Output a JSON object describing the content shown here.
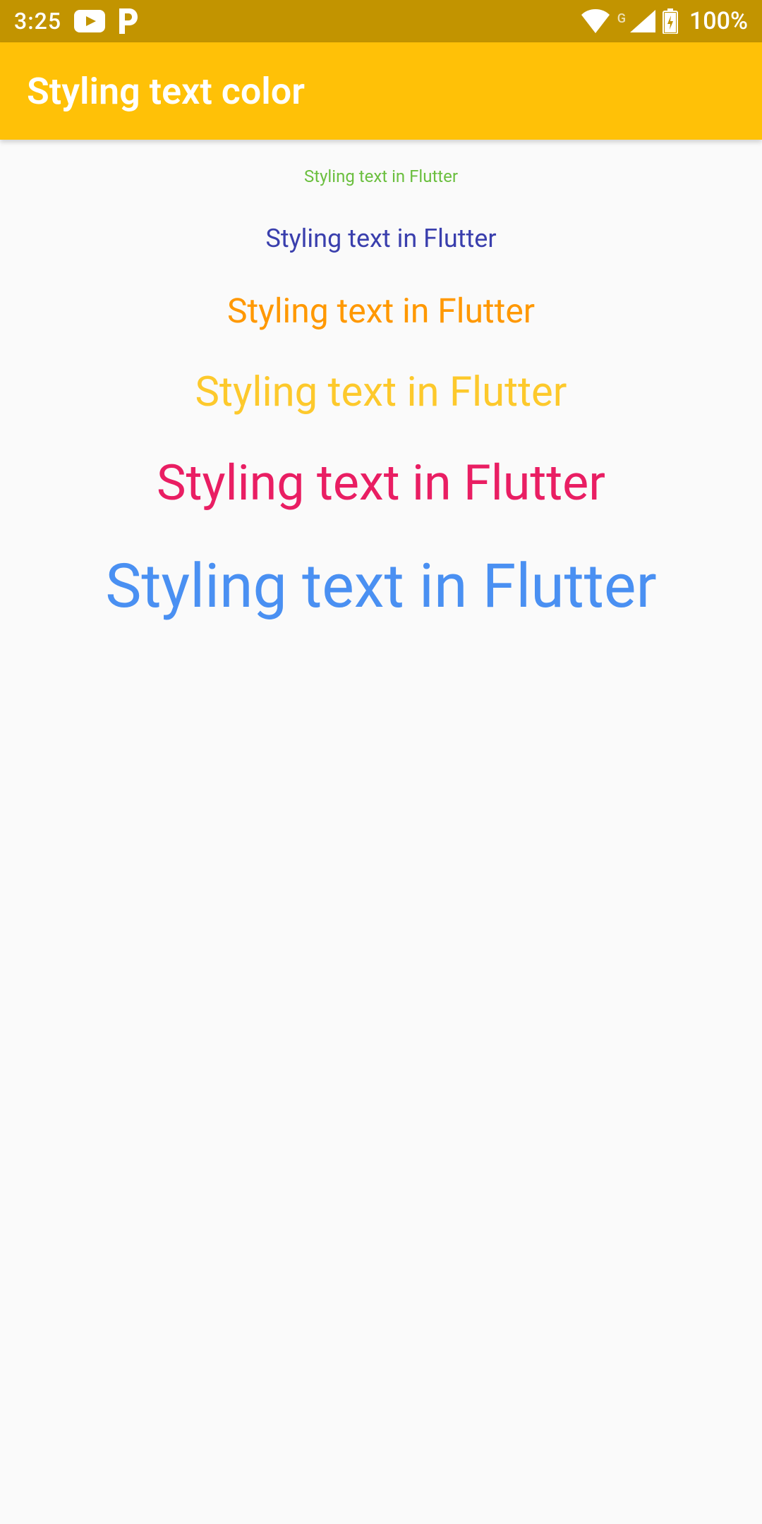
{
  "status_bar": {
    "time": "3:25",
    "battery": "100%",
    "network_indicator": "G",
    "icons": {
      "youtube": "youtube-icon",
      "pandora": "p-icon",
      "wifi": "wifi-icon",
      "signal": "signal-icon",
      "battery": "battery-charging-icon"
    }
  },
  "app_bar": {
    "title": "Styling text color"
  },
  "lines": [
    {
      "text": "Styling text in Flutter",
      "color": "#6bbf3f",
      "font_size": 24
    },
    {
      "text": "Styling text in Flutter",
      "color": "#3a3fad",
      "font_size": 36
    },
    {
      "text": "Styling text in Flutter",
      "color": "#ff9800",
      "font_size": 48
    },
    {
      "text": "Styling text in Flutter",
      "color": "#fdc92c",
      "font_size": 58
    },
    {
      "text": "Styling text in Flutter",
      "color": "#e91e63",
      "font_size": 70
    },
    {
      "text": "Styling text in Flutter",
      "color": "#4a90f2",
      "font_size": 86
    }
  ]
}
